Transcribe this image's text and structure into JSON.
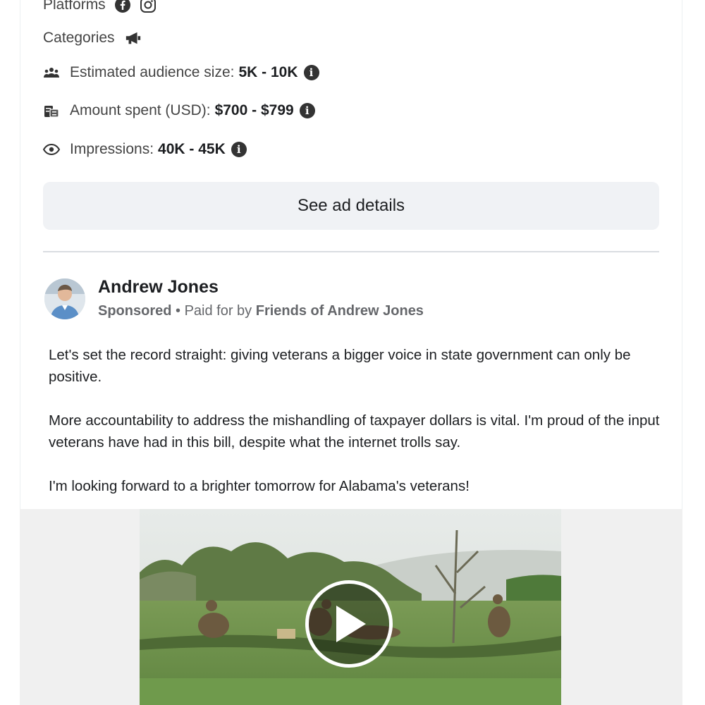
{
  "meta": {
    "platforms_label": "Platforms",
    "platform_icons": [
      "facebook-icon",
      "instagram-icon"
    ],
    "categories_label": "Categories",
    "categories_icon": "megaphone-icon",
    "audience": {
      "label": "Estimated audience size:",
      "value": "5K - 10K",
      "icon": "people-icon"
    },
    "spent": {
      "label": "Amount spent (USD):",
      "value": "$700 - $799",
      "icon": "money-icon"
    },
    "impressions": {
      "label": "Impressions:",
      "value": "40K - 45K",
      "icon": "eye-icon"
    }
  },
  "see_details_label": "See ad details",
  "ad": {
    "advertiser": "Andrew Jones",
    "sponsored": "Sponsored",
    "separator": " • ",
    "paid_for_prefix": "Paid for by ",
    "paid_for_by": "Friends of Andrew Jones",
    "paragraphs": [
      "Let's set the record straight: giving veterans a bigger voice in state government can only be positive.",
      "More accountability to address the mishandling of taxpayer dollars is vital. I'm proud of the input veterans have had in this bill, despite what the internet trolls say.",
      "I'm looking forward to a brighter tomorrow for Alabama's veterans!"
    ]
  },
  "colors": {
    "button_bg": "#f0f2f5",
    "secondary_text": "#65676b",
    "divider": "#dadde1"
  }
}
